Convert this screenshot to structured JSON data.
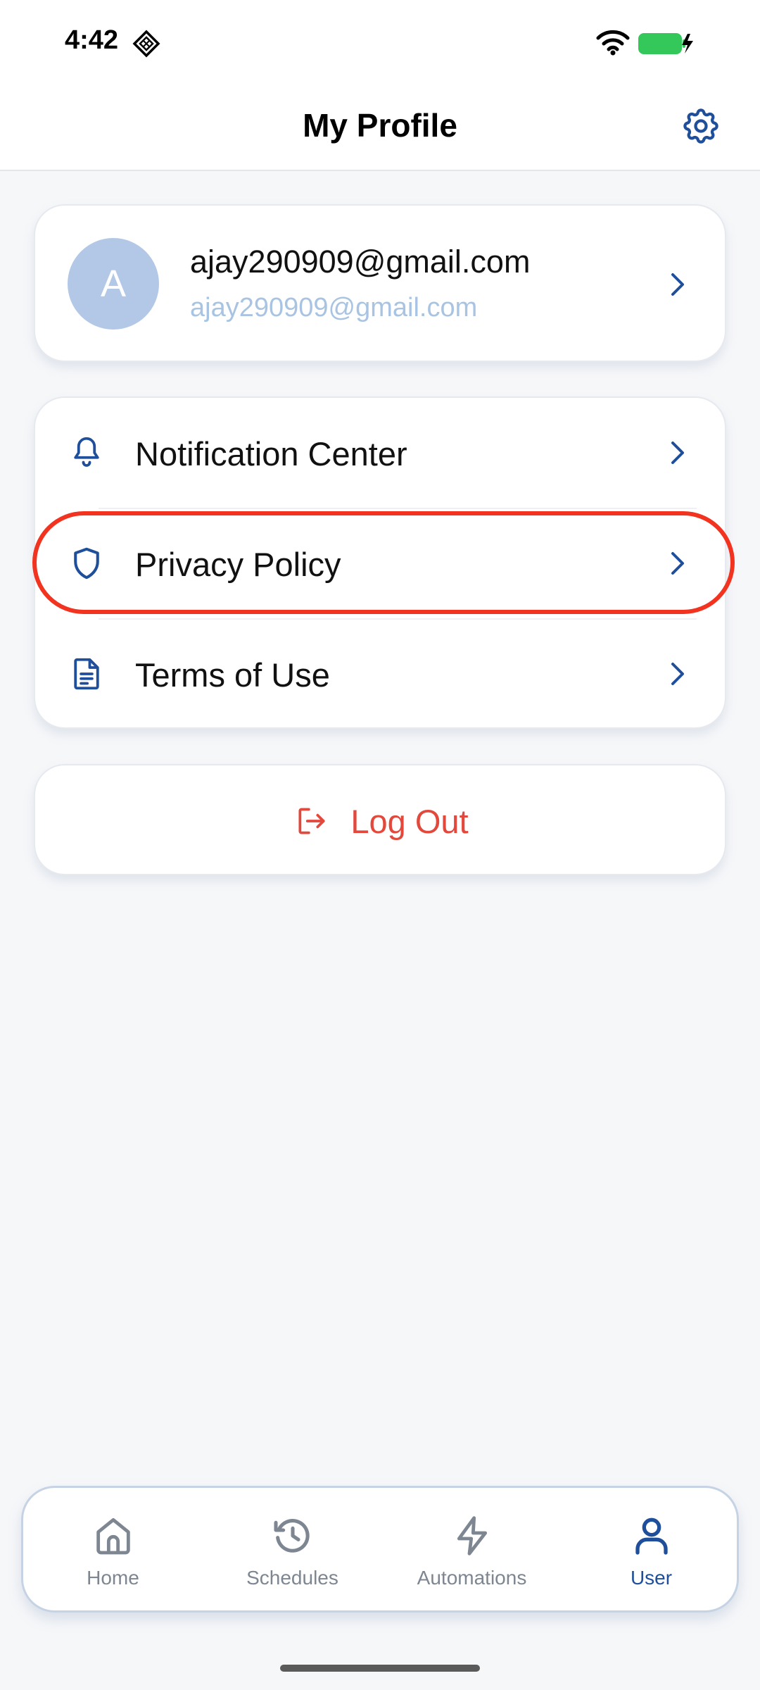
{
  "status_bar": {
    "time": "4:42"
  },
  "header": {
    "title": "My Profile",
    "settings_icon": "gear-icon"
  },
  "profile": {
    "avatar_letter": "A",
    "name": "ajay290909@gmail.com",
    "email": "ajay290909@gmail.com"
  },
  "menu": {
    "items": [
      {
        "label": "Notification Center",
        "icon": "bell-icon"
      },
      {
        "label": "Privacy Policy",
        "icon": "shield-icon"
      },
      {
        "label": "Terms of Use",
        "icon": "document-icon"
      }
    ]
  },
  "logout": {
    "label": "Log Out",
    "icon": "logout-icon"
  },
  "tabs": [
    {
      "label": "Home",
      "icon": "home-icon",
      "active": false
    },
    {
      "label": "Schedules",
      "icon": "history-icon",
      "active": false
    },
    {
      "label": "Automations",
      "icon": "lightning-icon",
      "active": false
    },
    {
      "label": "User",
      "icon": "user-icon",
      "active": true
    }
  ],
  "colors": {
    "accent": "#1f4f9a",
    "highlight": "#f2331f",
    "logout": "#e2483b",
    "avatar_bg": "#b2c8e6",
    "battery": "#34c759"
  }
}
